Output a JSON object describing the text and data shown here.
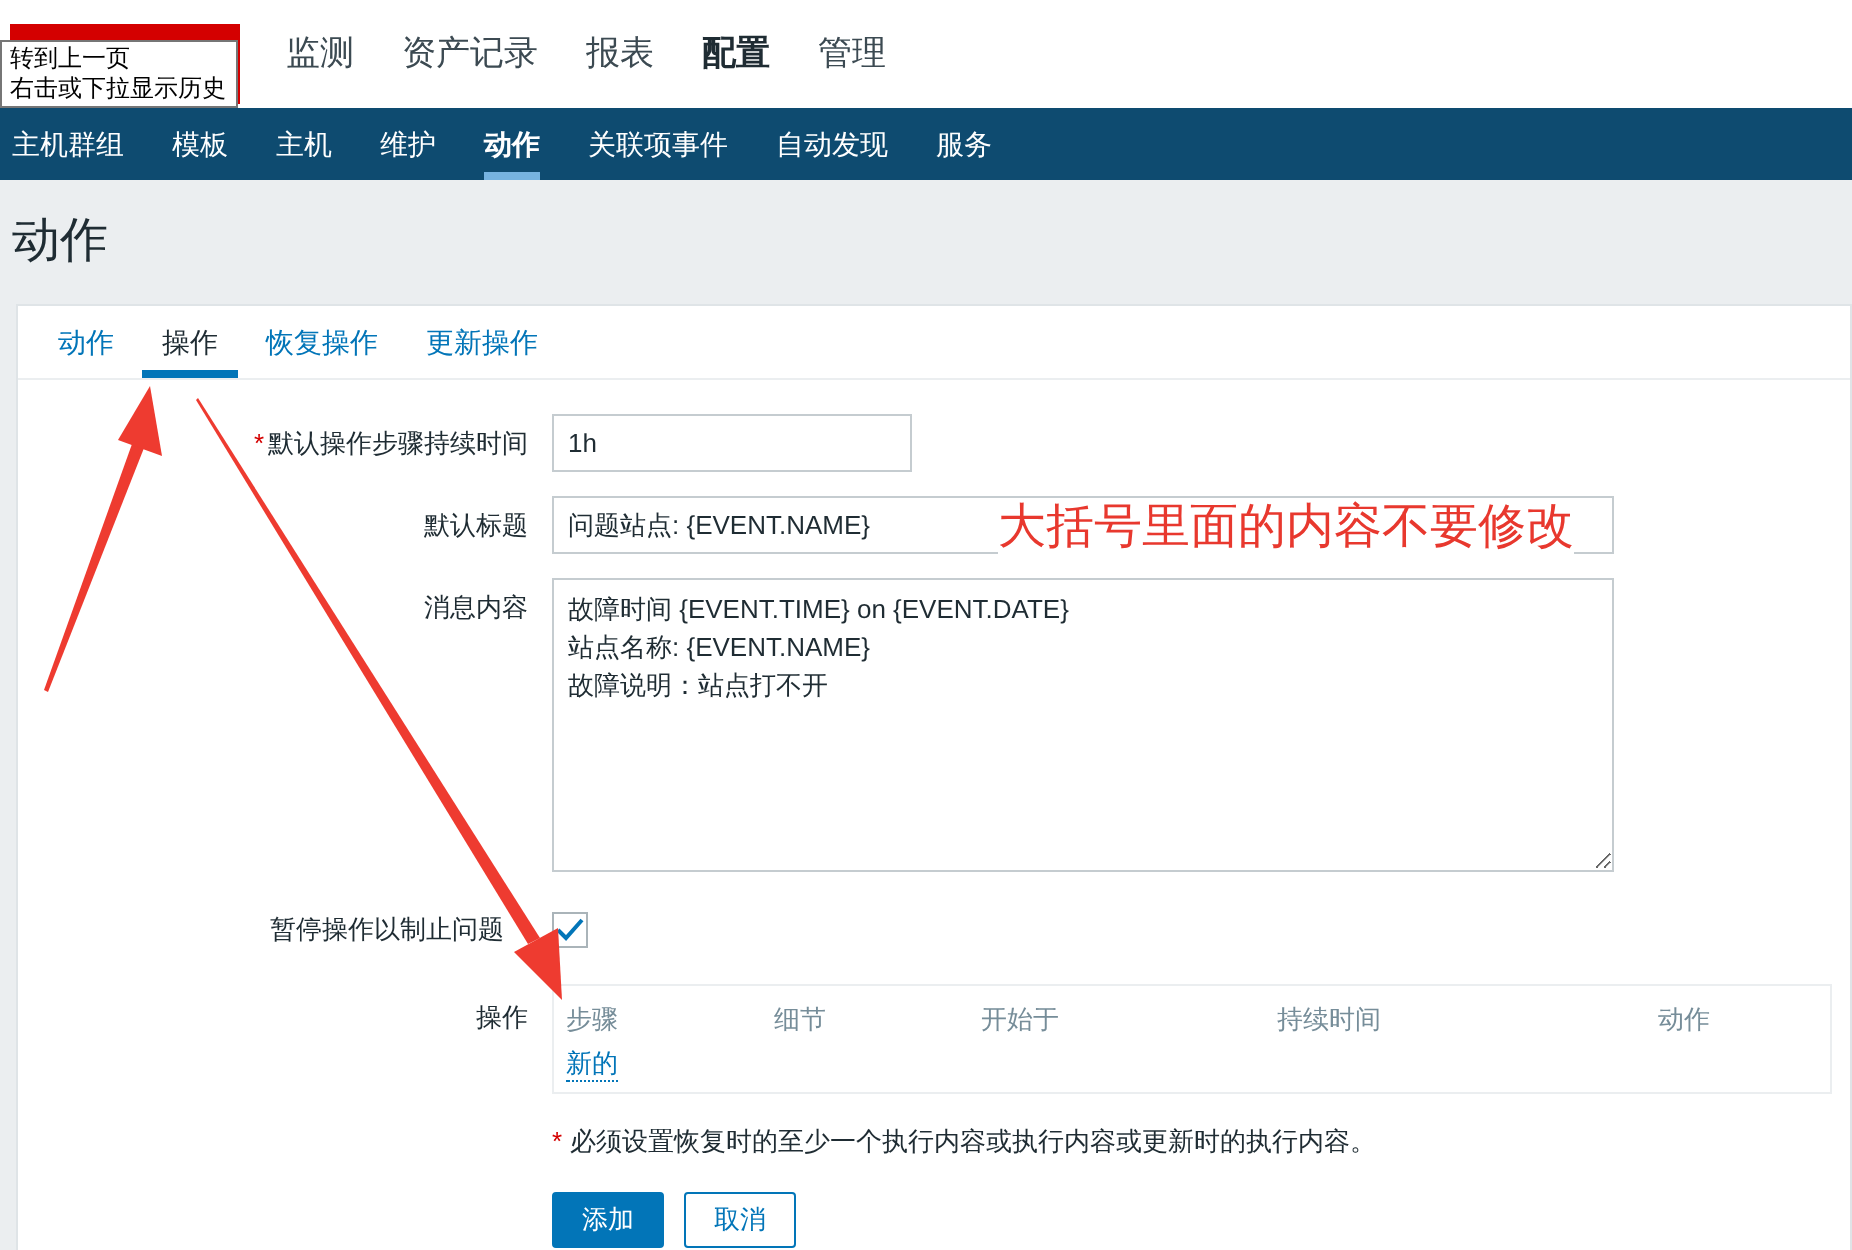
{
  "header": {
    "tooltip_lines": [
      "转到上一页",
      "右击或下拉显示历史"
    ],
    "main_menu": [
      {
        "label": "监测",
        "selected": false
      },
      {
        "label": "资产记录",
        "selected": false
      },
      {
        "label": "报表",
        "selected": false
      },
      {
        "label": "配置",
        "selected": true
      },
      {
        "label": "管理",
        "selected": false
      }
    ]
  },
  "sub_menu": [
    {
      "label": "主机群组",
      "selected": false
    },
    {
      "label": "模板",
      "selected": false
    },
    {
      "label": "主机",
      "selected": false
    },
    {
      "label": "维护",
      "selected": false
    },
    {
      "label": "动作",
      "selected": true
    },
    {
      "label": "关联项事件",
      "selected": false
    },
    {
      "label": "自动发现",
      "selected": false
    },
    {
      "label": "服务",
      "selected": false
    }
  ],
  "page_title": "动作",
  "tabs": [
    {
      "label": "动作",
      "selected": false
    },
    {
      "label": "操作",
      "selected": true
    },
    {
      "label": "恢复操作",
      "selected": false
    },
    {
      "label": "更新操作",
      "selected": false
    }
  ],
  "form": {
    "duration": {
      "required_mark": "*",
      "label": "默认操作步骤持续时间",
      "value": "1h"
    },
    "subject": {
      "label": "默认标题",
      "value": "问题站点: {EVENT.NAME}"
    },
    "message": {
      "label": "消息内容",
      "value": "故障时间 {EVENT.TIME} on {EVENT.DATE}\n站点名称: {EVENT.NAME}\n故障说明：站点打不开"
    },
    "pause": {
      "label": "暂停操作以制止问题",
      "checked": true
    },
    "operations": {
      "label": "操作",
      "columns": [
        "步骤",
        "细节",
        "开始于",
        "持续时间",
        "动作"
      ],
      "new_link": "新的"
    },
    "note": {
      "mark": "*",
      "text": "必须设置恢复时的至少一个执行内容或执行内容或更新时的执行内容。"
    },
    "buttons": [
      {
        "label": "添加",
        "kind": "primary"
      },
      {
        "label": "取消",
        "kind": "secondary"
      }
    ]
  },
  "annotation": {
    "text": "大括号里面的内容不要修改"
  }
}
